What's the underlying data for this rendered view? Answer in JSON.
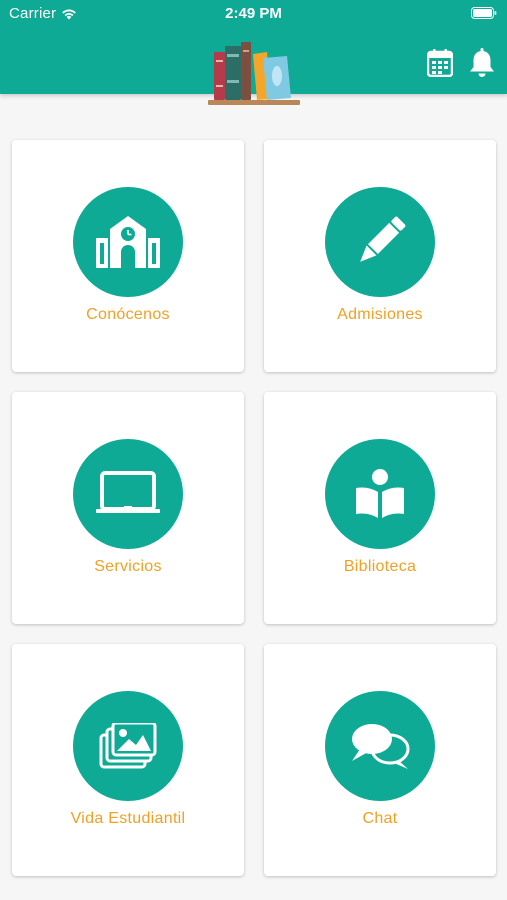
{
  "status_bar": {
    "carrier": "Carrier",
    "time": "2:49 PM"
  },
  "header": {
    "logo_icon": "bookshelf-logo",
    "actions": [
      {
        "icon": "calendar-icon"
      },
      {
        "icon": "bell-icon"
      }
    ]
  },
  "colors": {
    "primary": "#0faa96",
    "label": "#f0a124",
    "card": "#ffffff",
    "background": "#f6f6f6"
  },
  "menu": {
    "items": [
      {
        "label": "Conócenos",
        "icon": "school-building-icon"
      },
      {
        "label": "Admisiones",
        "icon": "pencil-icon"
      },
      {
        "label": "Servicios",
        "icon": "computer-board-icon"
      },
      {
        "label": "Biblioteca",
        "icon": "reading-person-icon"
      },
      {
        "label": "Vida Estudiantil",
        "icon": "photo-gallery-icon"
      },
      {
        "label": "Chat",
        "icon": "chat-bubbles-icon"
      }
    ]
  }
}
